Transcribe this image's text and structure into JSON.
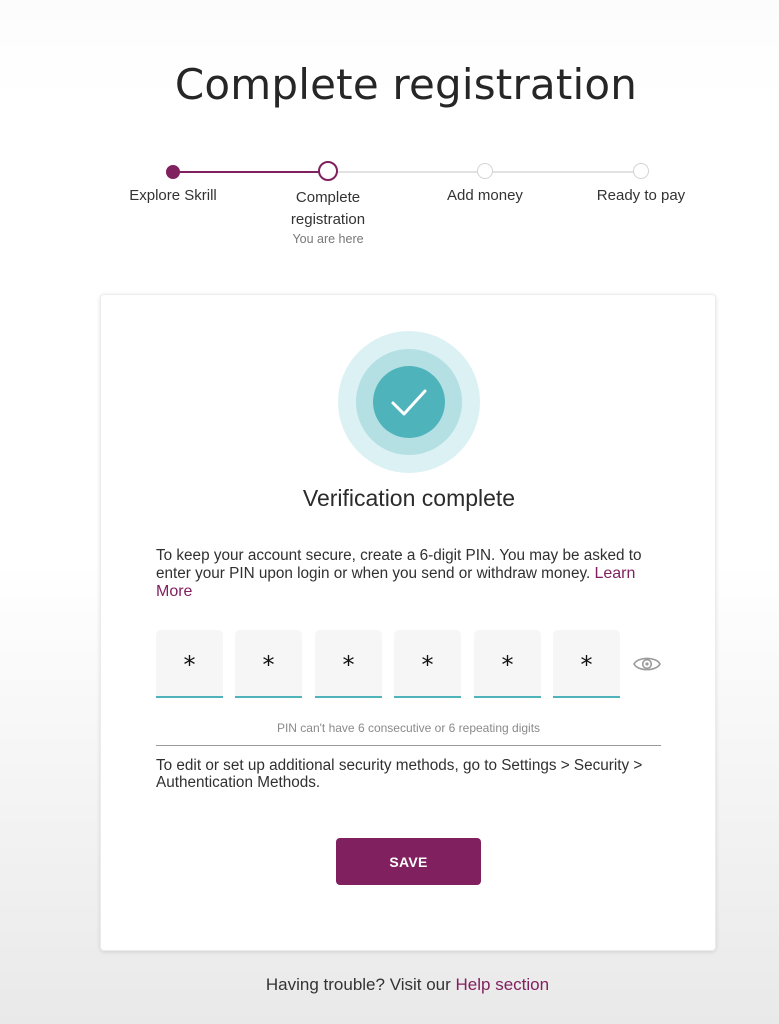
{
  "page": {
    "title": "Complete registration"
  },
  "stepper": {
    "steps": [
      {
        "label": "Explore Skrill",
        "state": "done"
      },
      {
        "label": "Complete registration",
        "state": "current",
        "sub": "You are here"
      },
      {
        "label": "Add money",
        "state": "todo"
      },
      {
        "label": "Ready to pay",
        "state": "todo"
      }
    ]
  },
  "card": {
    "icon": "check-circle-icon",
    "title": "Verification complete",
    "info_text": "To keep your account secure, create a 6-digit PIN. You may be asked to enter your PIN upon login or when you send or withdraw money.",
    "learn_more": "Learn More",
    "pin": {
      "digits": [
        "*",
        "*",
        "*",
        "*",
        "*",
        "*"
      ],
      "toggle_icon": "eye-icon",
      "hint": "PIN can't have 6 consecutive or 6 repeating digits"
    },
    "security_note": "To edit or set up additional security methods, go to Settings > Security > Authentication Methods.",
    "save_label": "SAVE"
  },
  "footer": {
    "help_prefix": "Having trouble? Visit our",
    "help_link": "Help section"
  },
  "colors": {
    "brand": "#80205e",
    "accent_teal": "#4fb3bc",
    "ring_light": "#dcf1f3",
    "ring_mid": "#b4e0e4"
  }
}
